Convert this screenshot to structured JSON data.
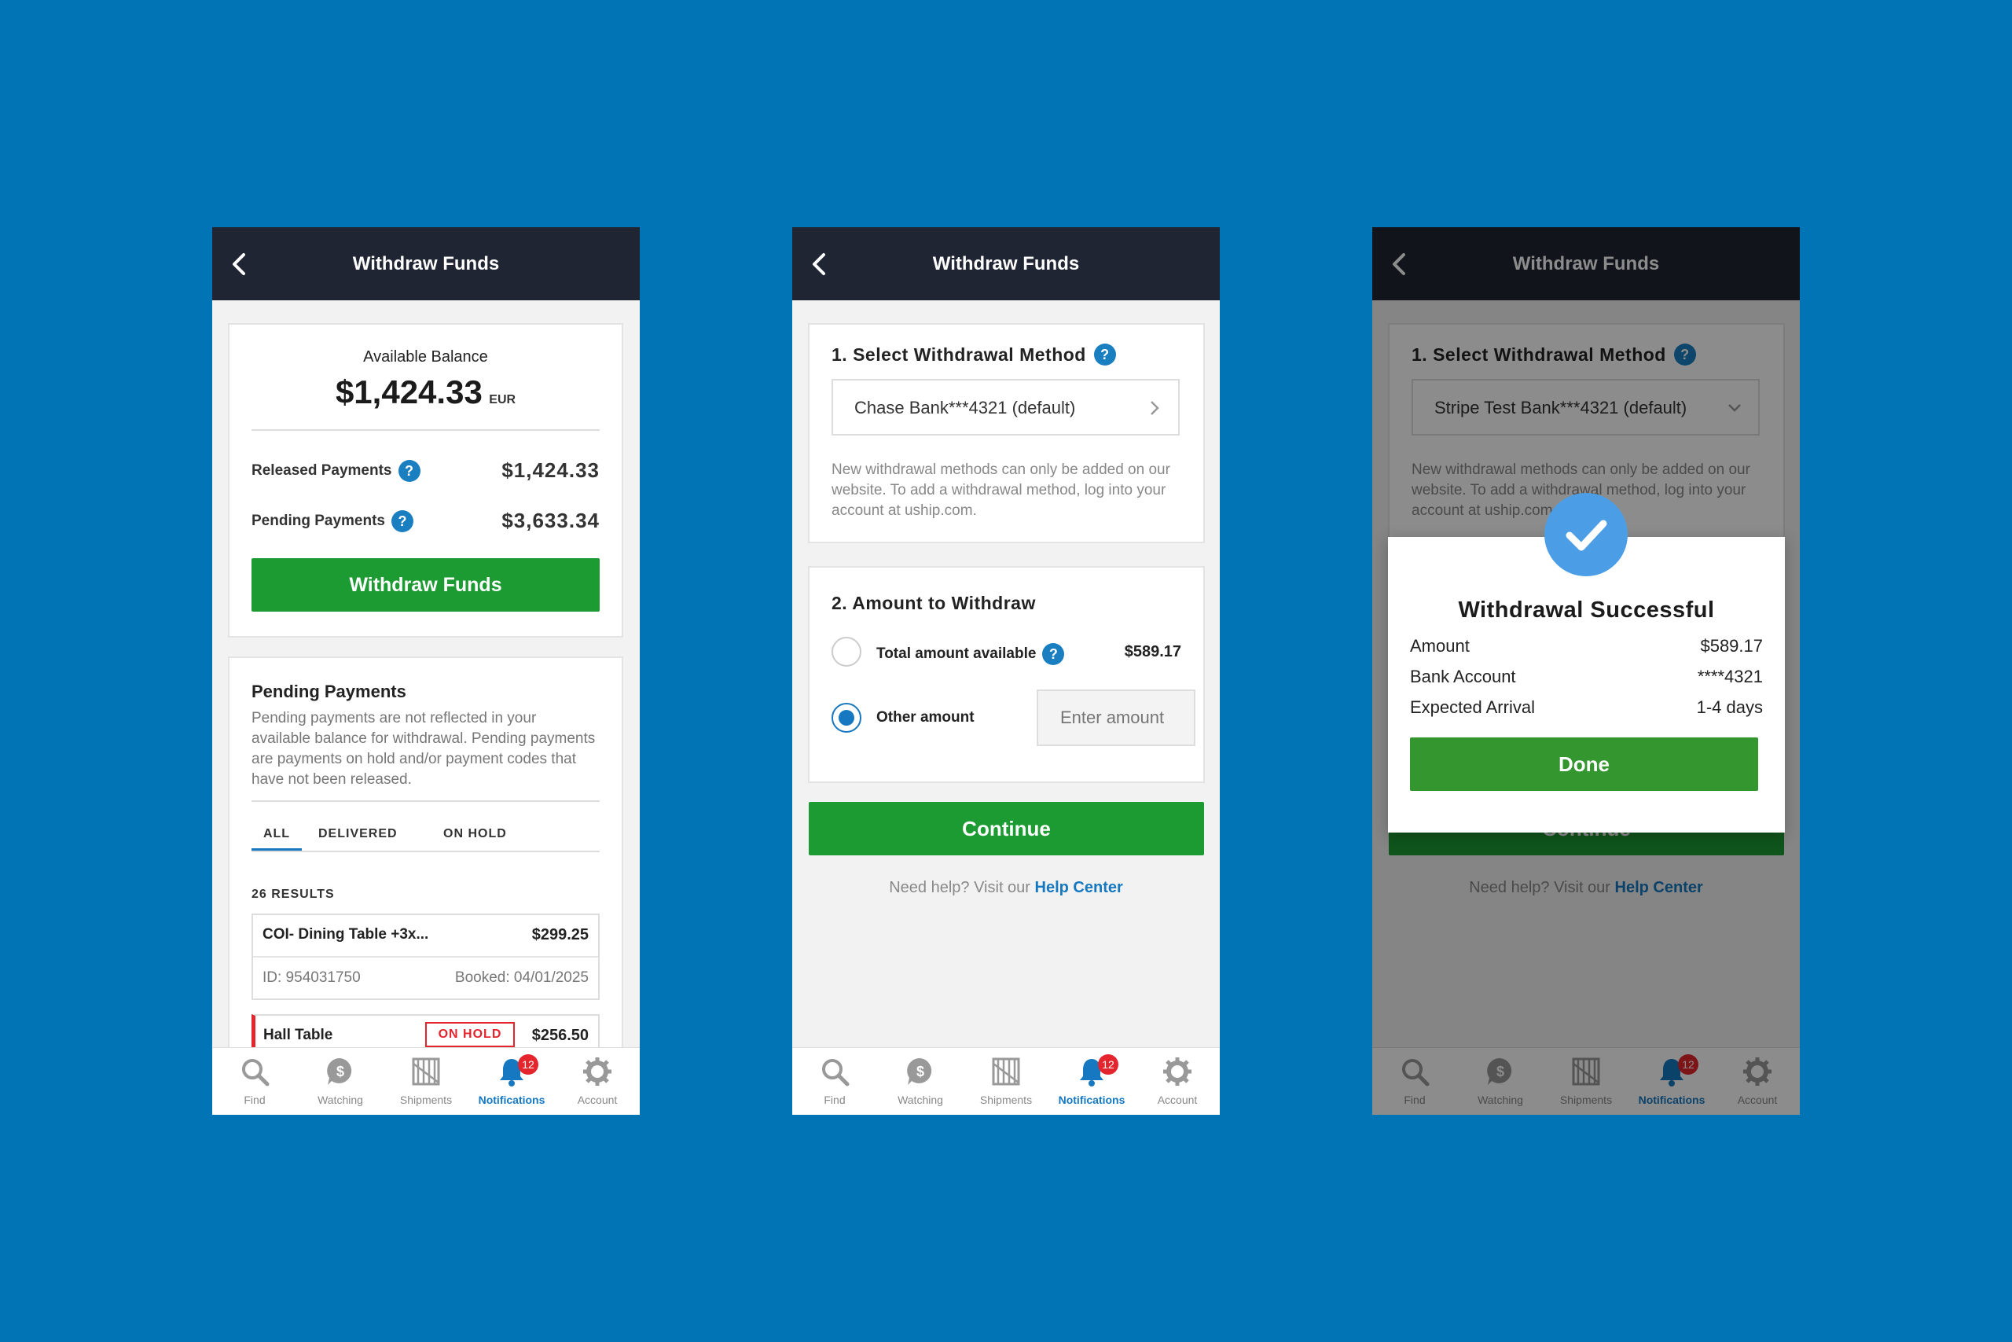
{
  "colors": {
    "background": "#0074b4",
    "header": "#1f2532",
    "primary_green": "#1d9b33",
    "link_blue": "#1578c0",
    "help_blue": "#1a7fc1",
    "badge_red": "#e4252d",
    "hold_red": "#e4252d"
  },
  "common": {
    "header_title": "Withdraw Funds",
    "tabs": [
      {
        "label": "Find",
        "icon": "search-icon"
      },
      {
        "label": "Watching",
        "icon": "dollar-bubble-icon"
      },
      {
        "label": "Shipments",
        "icon": "crate-icon"
      },
      {
        "label": "Notifications",
        "icon": "bell-icon",
        "badge": "12",
        "active": true
      },
      {
        "label": "Account",
        "icon": "gear-icon"
      }
    ],
    "help_glyph": "?"
  },
  "screen1": {
    "balance_label": "Available Balance",
    "balance_value": "$1,424.33",
    "balance_currency": "EUR",
    "released_label": "Released Payments",
    "released_value": "$1,424.33",
    "pending_label": "Pending Payments",
    "pending_value": "$3,633.34",
    "withdraw_button": "Withdraw Funds",
    "pending_title": "Pending Payments",
    "pending_desc": "Pending payments are not reflected in your available balance for withdrawal. Pending payments are payments on hold and/or payment codes that have not been released.",
    "filters": [
      "ALL",
      "DELIVERED",
      "ON HOLD"
    ],
    "results_count": "26 RESULTS",
    "items": [
      {
        "name": "COI- Dining Table +3x...",
        "amount": "$299.25",
        "id": "ID: 954031750",
        "booked": "Booked: 04/01/2025"
      },
      {
        "name": "Hall Table",
        "status": "ON HOLD",
        "amount": "$256.50"
      }
    ]
  },
  "screen2": {
    "section1_title": "1. Select Withdrawal Method",
    "method_value": "Chase Bank***4321 (default)",
    "method_note": "New withdrawal methods can only be added on our website. To add a withdrawal method, log into your account at uship.com.",
    "section2_title": "2. Amount to Withdraw",
    "option_total_label": "Total amount available",
    "option_total_value": "$589.17",
    "option_other_label": "Other amount",
    "amount_placeholder": "Enter amount",
    "continue_button": "Continue",
    "help_text": "Need help? Visit our",
    "help_link": "Help Center"
  },
  "screen3": {
    "section1_title": "1. Select Withdrawal Method",
    "method_value": "Stripe Test Bank***4321 (default)",
    "method_note": "New withdrawal methods can only be added on our website. To add a withdrawal method, log into your account at uship.com.",
    "continue_button": "Continue",
    "help_text": "Need help? Visit our",
    "help_link": "Help Center",
    "modal": {
      "title": "Withdrawal Successful",
      "rows": [
        {
          "label": "Amount",
          "value": "$589.17"
        },
        {
          "label": "Bank Account",
          "value": "****4321"
        },
        {
          "label": "Expected Arrival",
          "value": "1-4 days"
        }
      ],
      "done_button": "Done"
    }
  }
}
